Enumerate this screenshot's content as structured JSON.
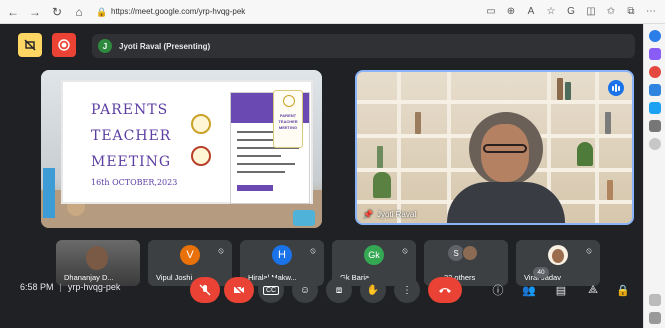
{
  "browser": {
    "url": "https://meet.google.com/yrp-hvqg-pek"
  },
  "meeting": {
    "presenter_label": "Jyoti Raval (Presenting)",
    "presenter_initial": "J",
    "time": "6:58 PM",
    "separator": "|",
    "code": "yrp-hvqg-pek",
    "participant_count": "40"
  },
  "slide": {
    "line1": "PARENTS",
    "line2": "TEACHER",
    "line3": "MEETING",
    "date": "16th OCTOBER,2023",
    "poster_line1": "PARENT",
    "poster_line2": "TEACHER",
    "poster_line3": "MEETING"
  },
  "camera_tile": {
    "name": "Jyoti Raval"
  },
  "participants": [
    {
      "name": "Dhananjay D...",
      "initial": "",
      "color": ""
    },
    {
      "name": "Vipul Joshi",
      "initial": "V",
      "color": "#e8710a"
    },
    {
      "name": "Hiralal Makw...",
      "initial": "H",
      "color": "#1a73e8"
    },
    {
      "name": "Gk Baria",
      "initial": "Gk",
      "color": "#34a853"
    },
    {
      "name": "32 others",
      "initial": "S",
      "color": "#5f6368"
    },
    {
      "name": "Viral Jadav",
      "initial": "",
      "color": "#f8f0e3"
    }
  ],
  "colors": {
    "meet_bg": "#202124",
    "tile_bg": "#3c4043",
    "end_call": "#ea4335",
    "muted": "#ea4335",
    "accent": "#8ab4f8"
  },
  "icons": [
    "back-icon",
    "forward-icon",
    "refresh-icon",
    "home-icon",
    "mic-off-icon",
    "camera-off-icon",
    "captions-icon",
    "emoji-icon",
    "present-icon",
    "raise-hand-icon",
    "more-icon",
    "end-call-icon",
    "info-icon",
    "people-icon",
    "chat-icon",
    "activities-icon",
    "host-controls-icon"
  ]
}
